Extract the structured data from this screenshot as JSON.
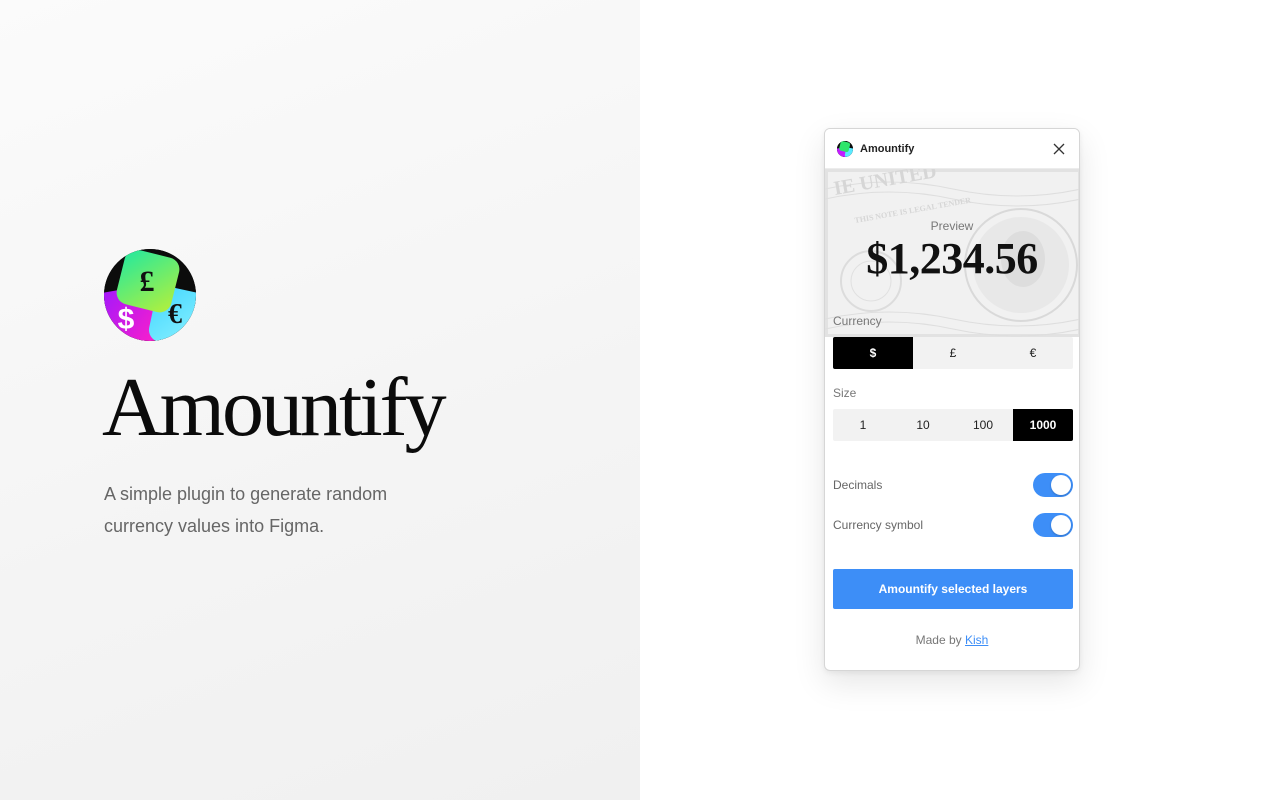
{
  "hero": {
    "brand": "Amountify",
    "tagline": "A simple plugin to generate random currency values into Figma."
  },
  "plugin": {
    "title": "Amountify",
    "preview_label": "Preview",
    "preview_value": "$1,234.56",
    "currency_label": "Currency",
    "currency_options": [
      "$",
      "£",
      "€"
    ],
    "currency_selected": "$",
    "size_label": "Size",
    "size_options": [
      "1",
      "10",
      "100",
      "1000"
    ],
    "size_selected": "1000",
    "toggles": [
      {
        "label": "Decimals",
        "on": true
      },
      {
        "label": "Currency symbol",
        "on": true
      }
    ],
    "action_label": "Amountify selected layers",
    "footer_prefix": "Made by",
    "footer_link": "Kish"
  },
  "colors": {
    "accent": "#3d8ef7",
    "selected": "#000000",
    "logo_green": "#2ee66b",
    "logo_magenta": "#c31cff",
    "logo_cyan": "#5ae9ff"
  }
}
